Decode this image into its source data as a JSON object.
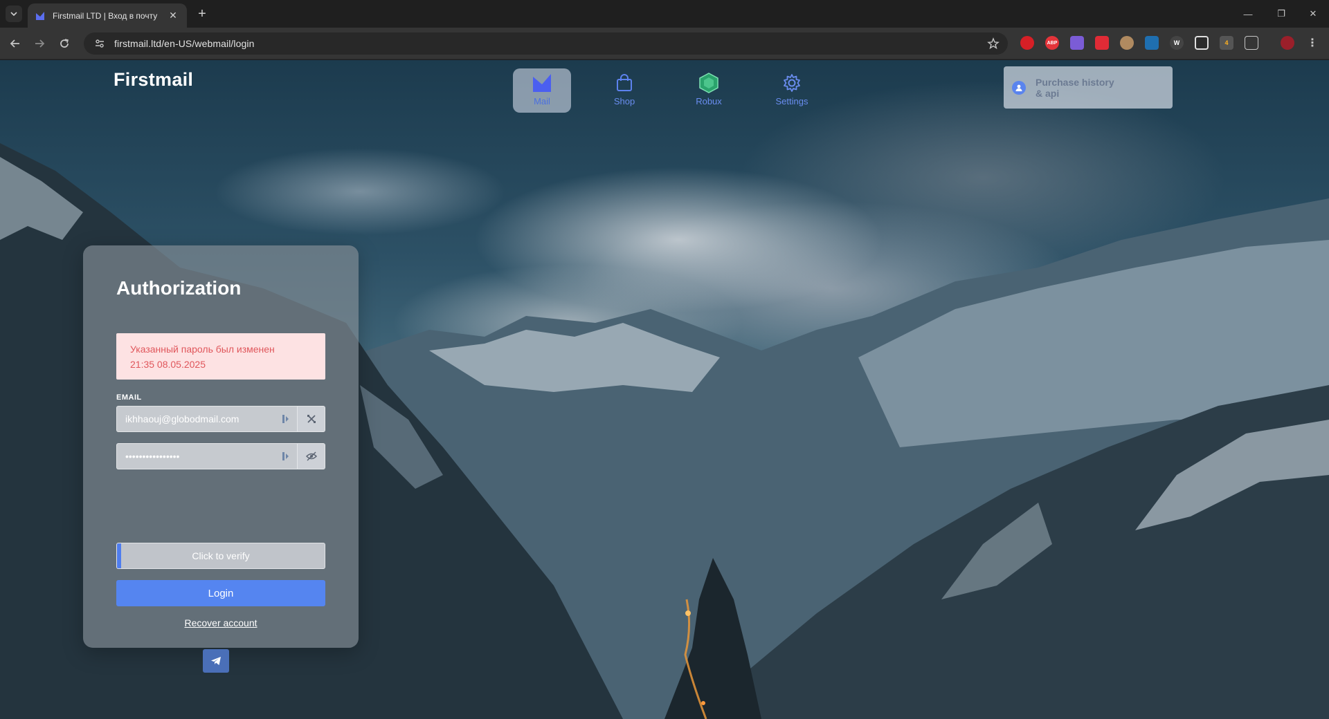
{
  "browser": {
    "tab_title": "Firstmail LTD | Вход в почту",
    "new_tab": "+",
    "url": "firstmail.ltd/en-US/webmail/login",
    "extensions": [
      {
        "name": "opera-icon",
        "text": ""
      },
      {
        "name": "abp-icon",
        "text": "ABP"
      },
      {
        "name": "shield-ext-icon",
        "text": ""
      },
      {
        "name": "red-ext-icon",
        "text": ""
      },
      {
        "name": "cookie-ext-icon",
        "text": ""
      },
      {
        "name": "blue-ext-icon",
        "text": ""
      },
      {
        "name": "w-ext-icon",
        "text": "W"
      },
      {
        "name": "square-ext-icon",
        "text": ""
      },
      {
        "name": "badge-ext-icon",
        "text": "4"
      },
      {
        "name": "puzzle-icon",
        "text": ""
      }
    ]
  },
  "site": {
    "brand": "Firstmail",
    "nav": [
      {
        "label": "Mail",
        "active": true
      },
      {
        "label": "Shop",
        "active": false
      },
      {
        "label": "Robux",
        "active": false
      },
      {
        "label": "Settings",
        "active": false
      }
    ],
    "purchase": {
      "line1": "Purchase history",
      "line2": "& api"
    }
  },
  "card": {
    "title": "Authorization",
    "alert_line1": "Указанный пароль был изменен",
    "alert_line2": "21:35 08.05.2025",
    "email_label": "EMAIL",
    "email_value": "ikhhaouj@globodmail.com",
    "password_value": "••••••••••••••••",
    "verify_label": "Click to verify",
    "login_label": "Login",
    "recover_label": "Recover account"
  },
  "colors": {
    "accent": "#5585f0",
    "alert_bg": "#fde2e3",
    "alert_text": "#e0565b"
  }
}
